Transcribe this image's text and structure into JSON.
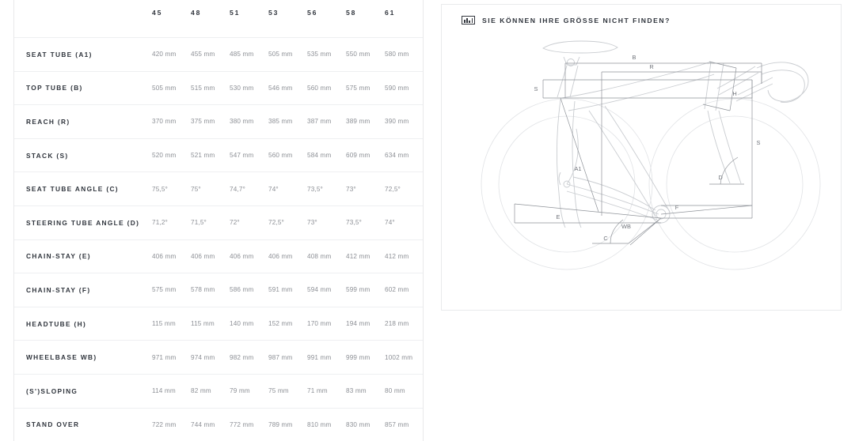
{
  "table": {
    "header": {
      "label_col": "",
      "sizes": [
        "45",
        "48",
        "51",
        "53",
        "56",
        "58",
        "61"
      ]
    },
    "rows": [
      {
        "label": "SEAT TUBE (A1)",
        "values": [
          "420 mm",
          "455 mm",
          "485 mm",
          "505 mm",
          "535 mm",
          "550 mm",
          "580 mm"
        ]
      },
      {
        "label": "TOP TUBE (B)",
        "values": [
          "505 mm",
          "515 mm",
          "530 mm",
          "546 mm",
          "560 mm",
          "575 mm",
          "590 mm"
        ]
      },
      {
        "label": "REACH (R)",
        "values": [
          "370 mm",
          "375 mm",
          "380 mm",
          "385 mm",
          "387 mm",
          "389 mm",
          "390 mm"
        ]
      },
      {
        "label": "STACK (S)",
        "values": [
          "520 mm",
          "521 mm",
          "547 mm",
          "560 mm",
          "584 mm",
          "609 mm",
          "634 mm"
        ]
      },
      {
        "label": "SEAT TUBE ANGLE (C)",
        "values": [
          "75,5°",
          "75°",
          "74,7°",
          "74°",
          "73,5°",
          "73°",
          "72,5°"
        ]
      },
      {
        "label": "STEERING TUBE ANGLE (D)",
        "values": [
          "71,2°",
          "71,5°",
          "72°",
          "72,5°",
          "73°",
          "73,5°",
          "74°"
        ]
      },
      {
        "label": "CHAIN-STAY (E)",
        "values": [
          "406 mm",
          "406 mm",
          "406 mm",
          "406 mm",
          "408 mm",
          "412 mm",
          "412 mm"
        ]
      },
      {
        "label": "CHAIN-STAY (F)",
        "values": [
          "575 mm",
          "578 mm",
          "586 mm",
          "591 mm",
          "594 mm",
          "599 mm",
          "602 mm"
        ]
      },
      {
        "label": "HEADTUBE (H)",
        "values": [
          "115 mm",
          "115 mm",
          "140 mm",
          "152 mm",
          "170 mm",
          "194 mm",
          "218 mm"
        ]
      },
      {
        "label": "WHEELBASE WB)",
        "values": [
          "971 mm",
          "974 mm",
          "982 mm",
          "987 mm",
          "991 mm",
          "999 mm",
          "1002 mm"
        ]
      },
      {
        "label": "(S')SLOPING",
        "values": [
          "114 mm",
          "82 mm",
          "79 mm",
          "75 mm",
          "71 mm",
          "83 mm",
          "80 mm"
        ]
      },
      {
        "label": "STAND OVER",
        "values": [
          "722 mm",
          "744 mm",
          "772 mm",
          "789 mm",
          "810 mm",
          "830 mm",
          "857 mm"
        ]
      }
    ]
  },
  "size_help": {
    "icon": "ruler-icon",
    "title": "SIE KÖNNEN IHRE GRÖSSE NICHT FINDEN?"
  },
  "diagram": {
    "name": "bicycle-geometry-diagram",
    "labels": {
      "top_tube": "B",
      "reach": "R",
      "stack_top": "S",
      "stack_right": "S",
      "headtube": "H",
      "seat_tube": "A1",
      "chainstay_e": "E",
      "chainstay_f": "F",
      "seat_tube_angle": "C",
      "steering_tube_angle": "D",
      "wheelbase": "WB"
    }
  },
  "colors": {
    "text_dark": "#2f343c",
    "text_muted": "#8d9096",
    "border": "#e8e9eb",
    "row_divider": "#eeeff1",
    "diagram_line": "#8f9399",
    "diagram_faint": "#dcdee1"
  }
}
